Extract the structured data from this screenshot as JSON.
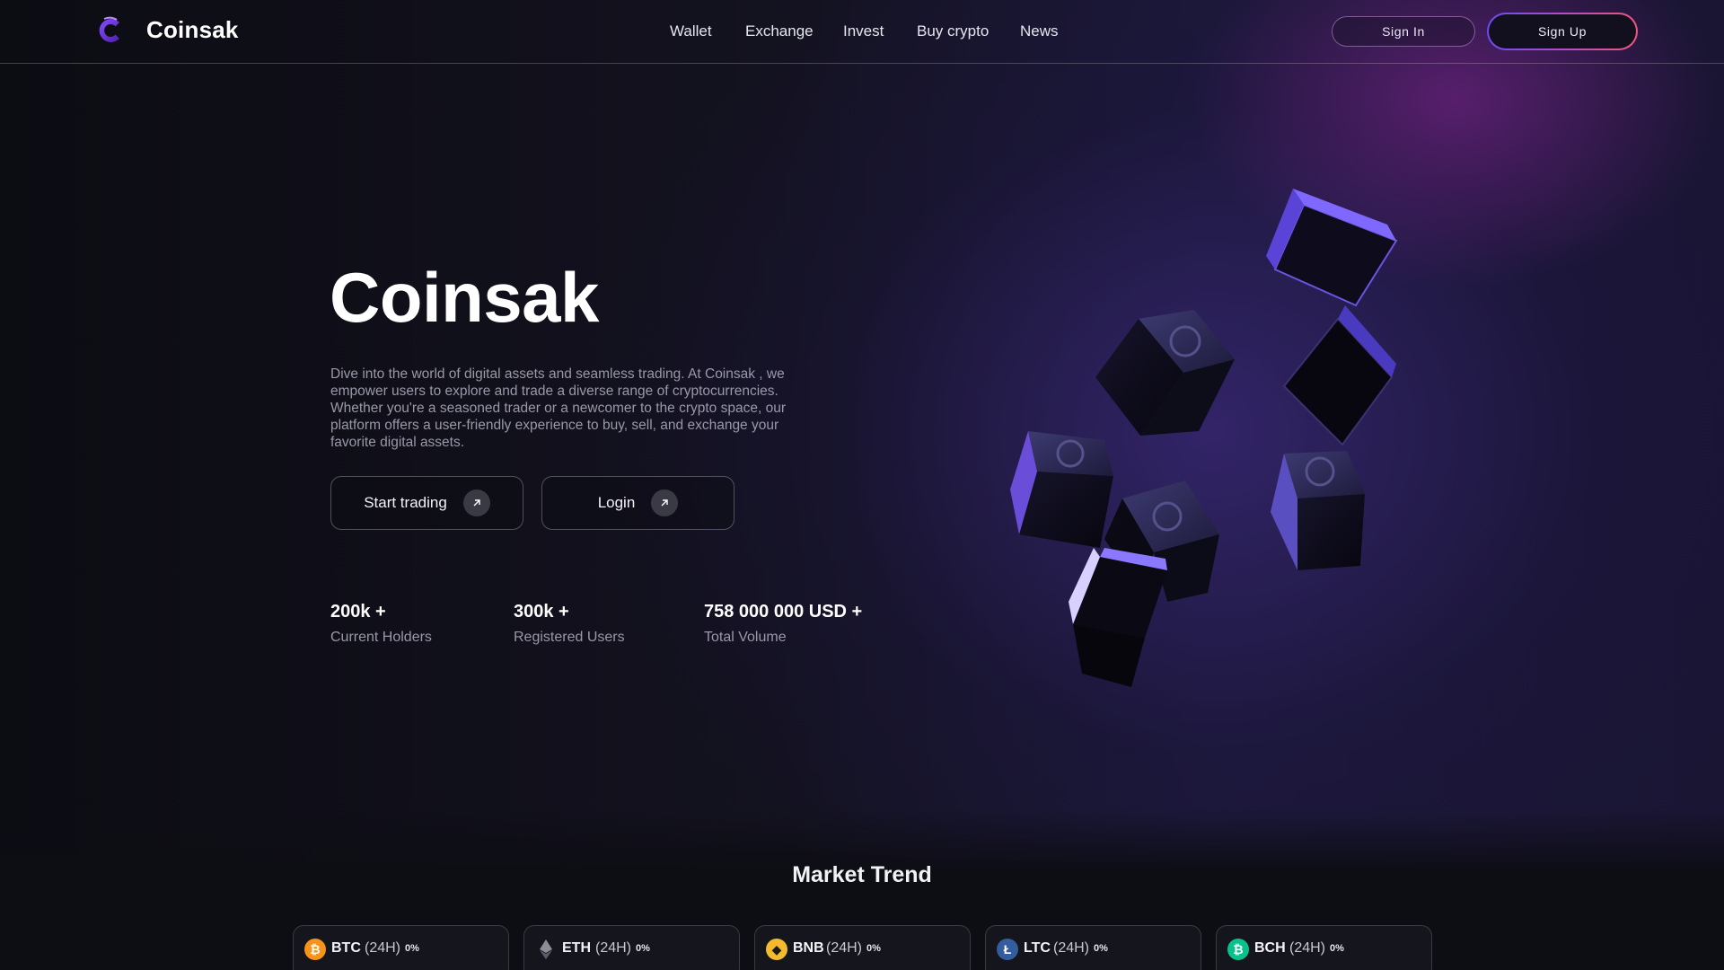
{
  "brand": {
    "name": "Coinsak"
  },
  "nav": {
    "items": [
      "Wallet",
      "Exchange",
      "Invest",
      "Buy crypto",
      "News"
    ]
  },
  "auth": {
    "signin_label": "Sign In",
    "signup_label": "Sign Up"
  },
  "hero": {
    "title": "Coinsak",
    "description": "Dive into the world of digital assets and seamless trading. At Coinsak , we empower users to explore and trade a diverse range of cryptocurrencies. Whether you're a seasoned trader or a newcomer to the crypto space, our platform offers a user-friendly experience to buy, sell, and exchange your favorite digital assets.",
    "buttons": [
      {
        "label": "Start trading",
        "icon": "arrow-up-right-icon"
      },
      {
        "label": "Login",
        "icon": "arrow-up-right-icon"
      }
    ]
  },
  "stats": [
    {
      "value": "200k +",
      "label": "Current Holders"
    },
    {
      "value": "300k +",
      "label": "Registered Users"
    },
    {
      "value": "758 000 000 USD +",
      "label": "Total Volume"
    }
  ],
  "market": {
    "title": "Market Trend",
    "tickers": [
      {
        "symbol": "BTC",
        "period": "(24H)",
        "change": "0%",
        "icon": "bitcoin-icon",
        "color": "#f7931a"
      },
      {
        "symbol": "ETH",
        "period": "(24H)",
        "change": "0%",
        "icon": "ethereum-icon",
        "color": "#8c8c9a"
      },
      {
        "symbol": "BNB",
        "period": "(24H)",
        "change": "0%",
        "icon": "binance-icon",
        "color": "#f3ba2f"
      },
      {
        "symbol": "LTC",
        "period": "(24H)",
        "change": "0%",
        "icon": "litecoin-icon",
        "color": "#345d9d"
      },
      {
        "symbol": "BCH",
        "period": "(24H)",
        "change": "0%",
        "icon": "bitcoin-cash-icon",
        "color": "#0ac18e"
      }
    ]
  },
  "colors": {
    "accent_purple": "#6a4df0",
    "accent_pink": "#f0567e",
    "background": "#0b0b12",
    "muted_text": "#9a98a8"
  }
}
